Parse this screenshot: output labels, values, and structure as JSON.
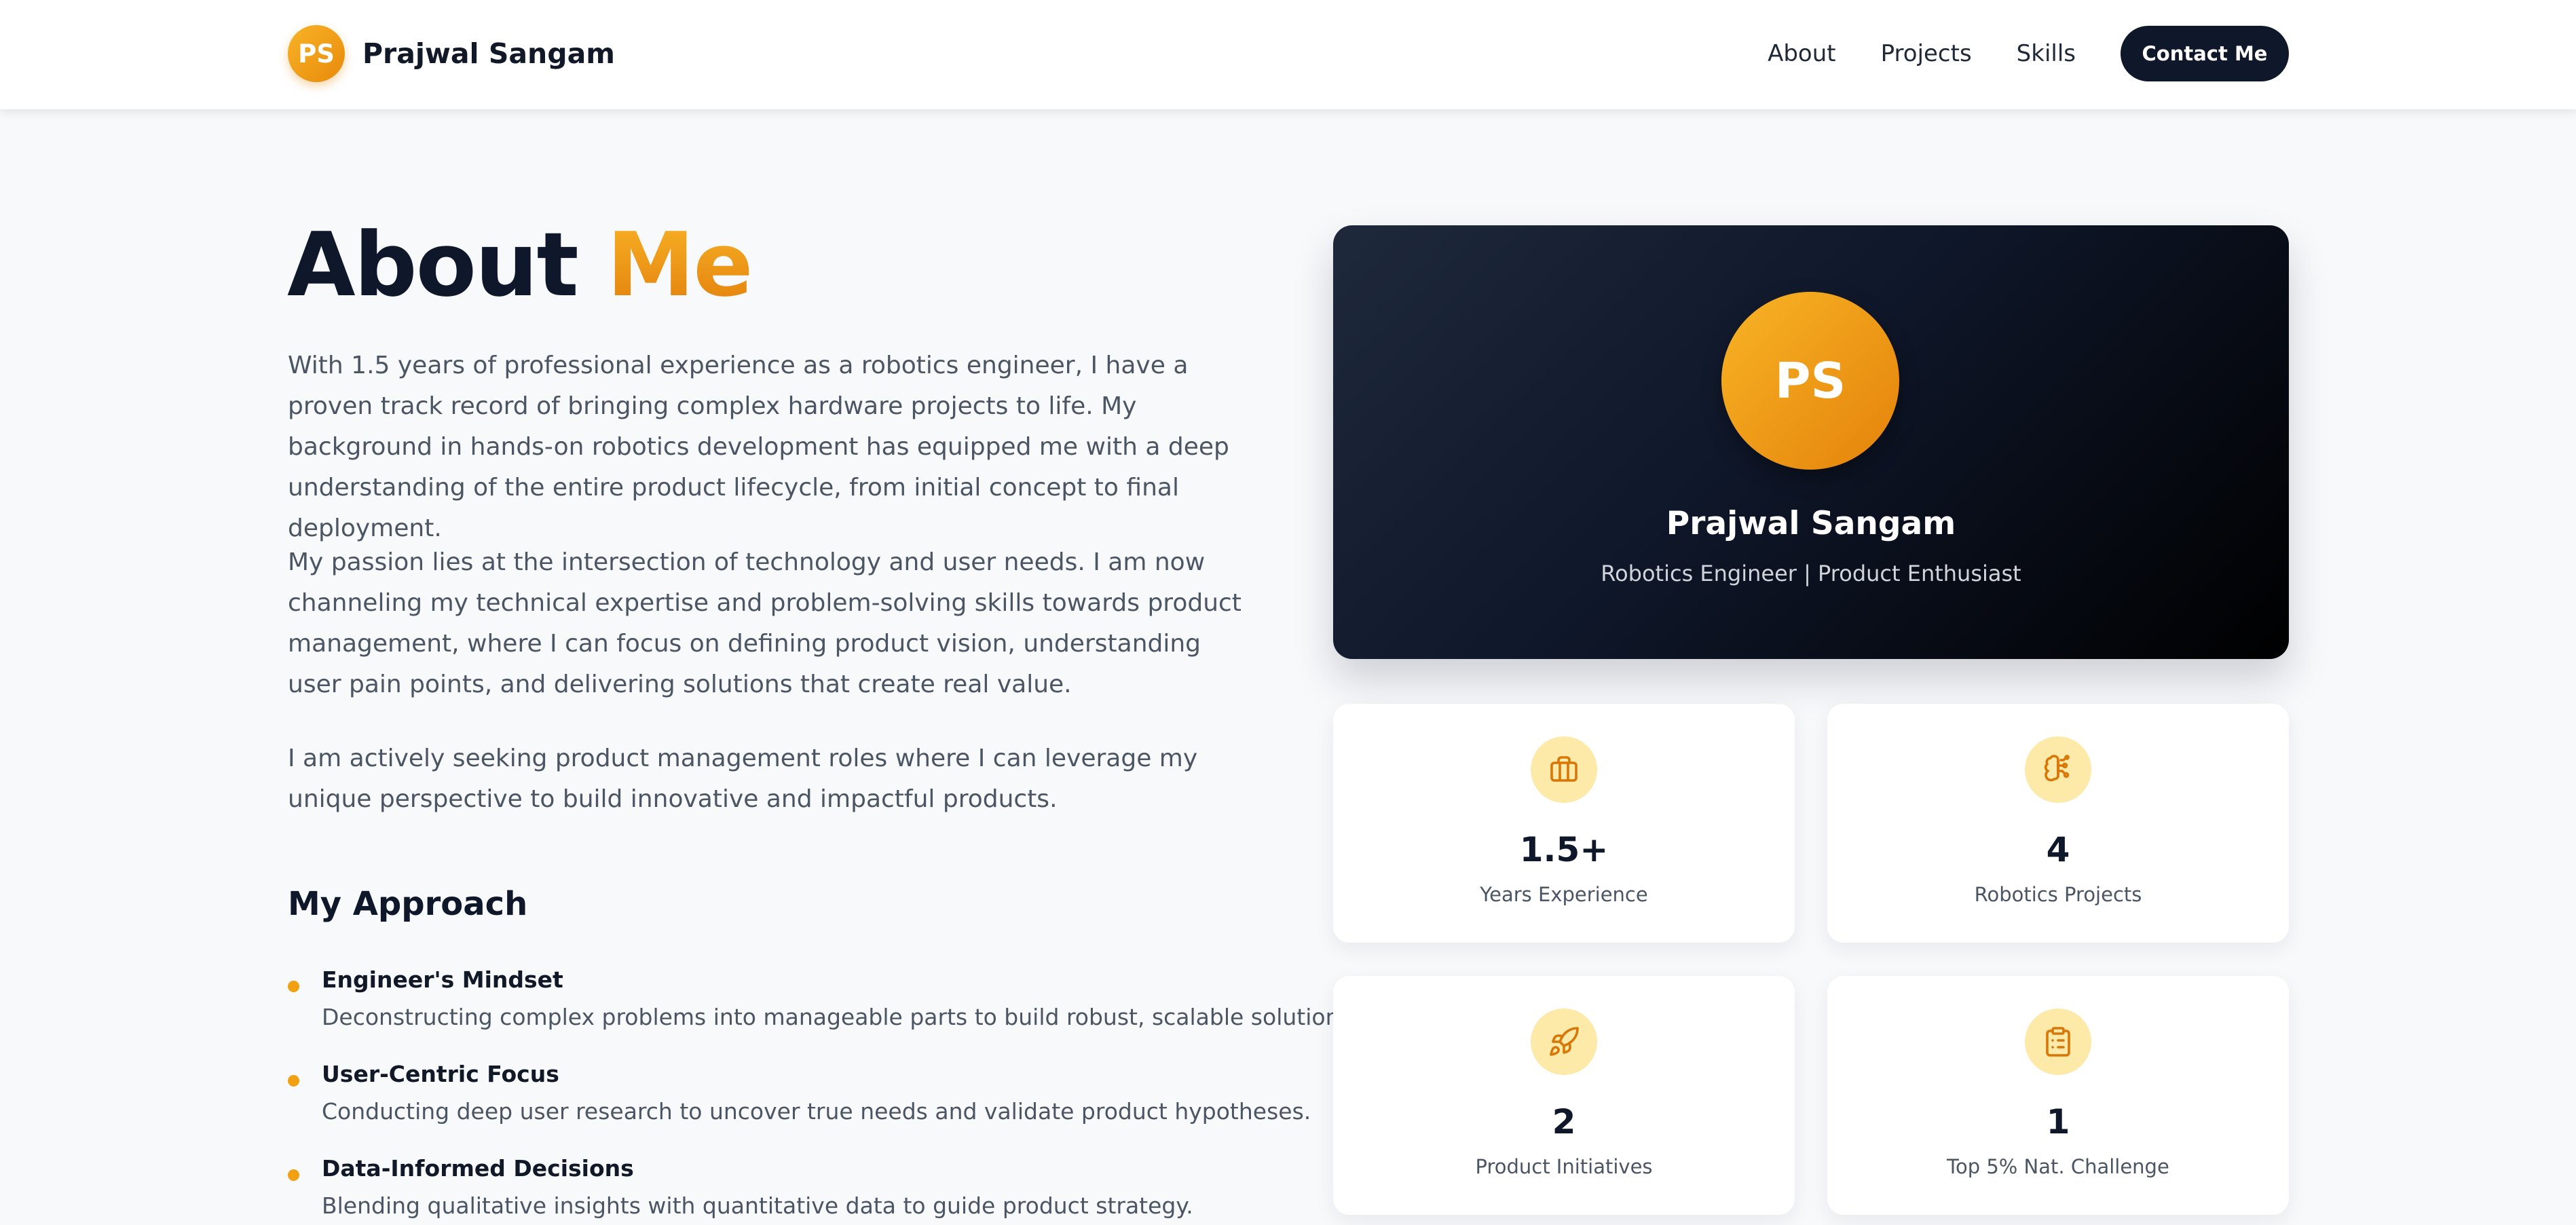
{
  "nav": {
    "logo_initials": "PS",
    "brand_name": "Prajwal Sangam",
    "links": [
      "About",
      "Projects",
      "Skills"
    ],
    "cta": "Contact Me"
  },
  "about": {
    "title_main": "About",
    "title_accent": "Me",
    "paragraphs": [
      "With 1.5 years of professional experience as a robotics engineer, I have a proven track record of bringing complex hardware projects to life. My background in hands-on robotics development has equipped me with a deep understanding of the entire product lifecycle, from initial concept to final deployment.",
      "My passion lies at the intersection of technology and user needs. I am now channeling my technical expertise and problem-solving skills towards product management, where I can focus on defining product vision, understanding user pain points, and delivering solutions that create real value.",
      "I am actively seeking product management roles where I can leverage my unique perspective to build innovative and impactful products."
    ]
  },
  "approach": {
    "heading": "My Approach",
    "items": [
      {
        "title": "Engineer's Mindset",
        "description": "Deconstructing complex problems into manageable parts to build robust, scalable solutions."
      },
      {
        "title": "User-Centric Focus",
        "description": "Conducting deep user research to uncover true needs and validate product hypotheses."
      },
      {
        "title": "Data-Informed Decisions",
        "description": "Blending qualitative insights with quantitative data to guide product strategy."
      }
    ]
  },
  "profile": {
    "initials": "PS",
    "name": "Prajwal Sangam",
    "role": "Robotics Engineer | Product Enthusiast"
  },
  "stats": [
    {
      "icon": "briefcase-icon",
      "value": "1.5+",
      "label": "Years Experience"
    },
    {
      "icon": "brain-circuit-icon",
      "value": "4",
      "label": "Robotics Projects"
    },
    {
      "icon": "rocket-icon",
      "value": "2",
      "label": "Product Initiatives"
    },
    {
      "icon": "clipboard-list-icon",
      "value": "1",
      "label": "Top 5% Nat. Challenge"
    }
  ],
  "colors": {
    "accent": "#f2a012",
    "dark": "#0f172a",
    "icon_bg": "#fde9a8",
    "icon_stroke": "#d97706"
  }
}
